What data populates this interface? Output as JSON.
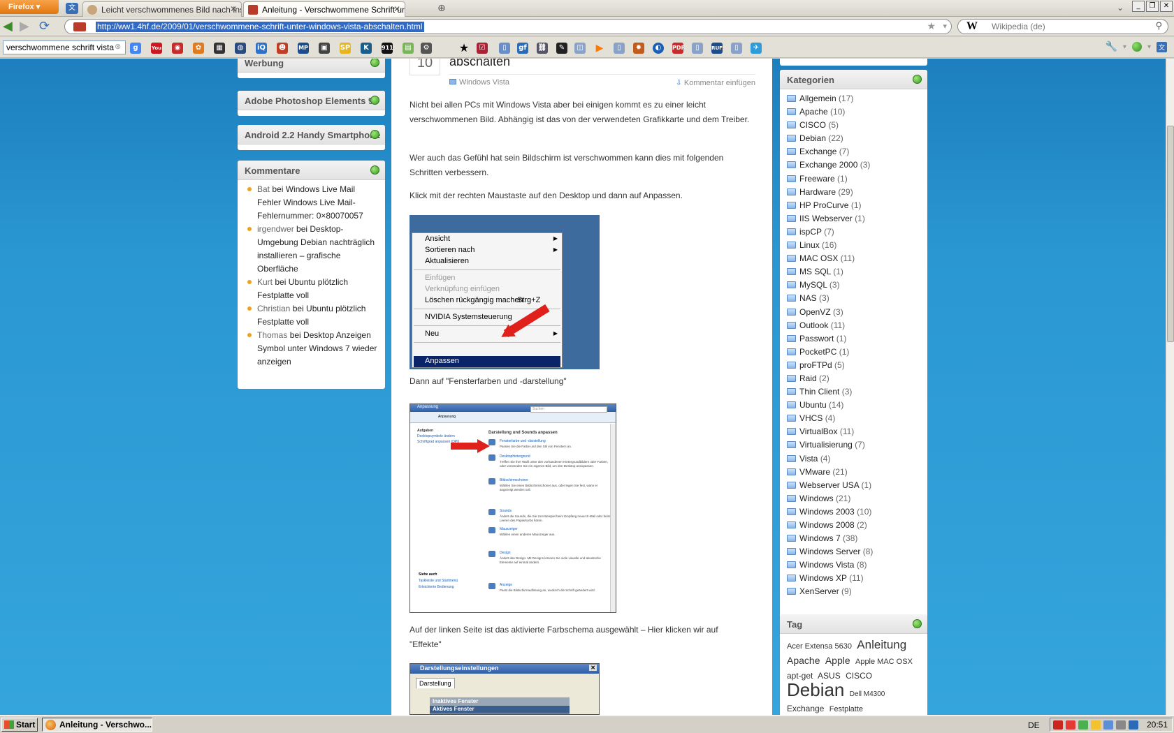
{
  "browser": {
    "app_button": "Firefox",
    "tabs": [
      {
        "title": "Leicht verschwommenes Bild nach Inst..."
      },
      {
        "title": "Anleitung - Verschwommene Schrift un..."
      }
    ],
    "url": "http://ww1.4hf.de/2009/01/verschwommene-schrift-unter-windows-vista-abschalten.html",
    "search_placeholder": "Wikipedia (de)",
    "search_engine_label": "W",
    "toolbar_search_value": "verschwommene schrift vista"
  },
  "left_sidebar": {
    "widgets": [
      {
        "title": "Werbung"
      },
      {
        "title": "Adobe Photoshop Elements 9"
      },
      {
        "title": "Android 2.2 Handy Smartphone"
      },
      {
        "title": "Kommentare"
      }
    ],
    "comments": [
      {
        "author": "Bat",
        "sep": " bei ",
        "post": "Windows Live Mail Fehler Windows Live Mail-Fehlernummer: 0×80070057"
      },
      {
        "author": "irgendwer",
        "sep": " bei ",
        "post": "Desktop-Umgebung Debian nachträglich installieren – grafische Oberfläche"
      },
      {
        "author": "Kurt",
        "sep": " bei ",
        "post": "Ubuntu plötzlich Festplatte voll"
      },
      {
        "author": "Christian",
        "sep": " bei ",
        "post": "Ubuntu plötzlich Festplatte voll"
      },
      {
        "author": "Thomas",
        "sep": " bei ",
        "post": "Desktop Anzeigen Symbol unter Windows 7 wieder anzeigen"
      }
    ]
  },
  "post": {
    "day": "10",
    "title": "abschalten",
    "category": "Windows Vista",
    "comment_link": "Kommentar einfügen",
    "paragraphs": [
      "Nicht bei allen PCs mit Windows Vista aber bei einigen kommt es zu einer leicht verschwommenen Bild. Abhängig ist das von der verwendeten Grafikkarte und dem Treiber.",
      "Wer auch das Gefühl hat sein Bildschirm ist verschwommen kann dies mit folgenden Schritten verbessern.",
      "Klick mit der rechten Maustaste auf den Desktop und dann auf Anpassen.",
      "Dann auf \"Fensterfarben und -darstellung\"",
      "Auf der linken Seite ist das aktivierte Farbschema ausgewählt – Hier klicken wir auf \"Effekte\""
    ],
    "context_menu": {
      "items": [
        "Ansicht",
        "Sortieren nach",
        "Aktualisieren",
        "Einfügen",
        "Verknüpfung einfügen",
        "Löschen rückgängig machen",
        "Strg+Z",
        "NVIDIA Systemsteuerung",
        "Neu",
        "Anpassen"
      ]
    },
    "shot2": {
      "title": "Anpassung",
      "address": "Anpassung",
      "search": "Suchen",
      "tasks_header": "Aufgaben",
      "tasks": [
        "Desktopsymbole ändern",
        "Schriftgrad anpassen (DPI)"
      ],
      "heading": "Darstellung und Sounds anpassen",
      "entries": [
        {
          "link": "Fensterfarbe und -darstellung",
          "text": "Passen Sie die Farbe und den Stil von Fenstern an."
        },
        {
          "link": "Desktophintergrund",
          "text": "Treffen Sie Ihre Wahl unter den vorhandenen Hintergrundbildern oder Farben, oder verwenden Sie ein eigenes Bild, um den Desktop anzupassen."
        },
        {
          "link": "Bildschirmschoner",
          "text": "Wählen Sie einen Bildschirmschoner aus, oder legen Sie fest, wann er angezeigt werden soll."
        },
        {
          "link": "Sounds",
          "text": "Ändert die Sounds, die Sie zum Beispiel beim Empfang neuer E-Mail oder beim Leeren des Papierkorbs hören."
        },
        {
          "link": "Mauszeiger",
          "text": "Wählen einen anderen Mauszeiger aus."
        },
        {
          "link": "Design",
          "text": "Ändert das Design. Mit Designs können Sie viele visuelle und akustische Elemente auf einmal ändern."
        },
        {
          "link": "Anzeige",
          "text": "Passt die Bildschirmauflösung an, wodurch die Schrift geändert wird."
        }
      ],
      "see_also": "Siehe auch",
      "see_links": [
        "Taskleiste und Startmenü",
        "Erleichterte Bedienung"
      ]
    },
    "shot3": {
      "title": "Darstellungseinstellungen",
      "tab": "Darstellung",
      "inner_title": "Inaktives Fenster",
      "inner_title2": "Aktives Fenster"
    }
  },
  "right_sidebar": {
    "categories_title": "Kategorien",
    "categories": [
      {
        "name": "Allgemein",
        "count": "(17)"
      },
      {
        "name": "Apache",
        "count": "(10)"
      },
      {
        "name": "CISCO",
        "count": "(5)"
      },
      {
        "name": "Debian",
        "count": "(22)"
      },
      {
        "name": "Exchange",
        "count": "(7)"
      },
      {
        "name": "Exchange 2000",
        "count": "(3)"
      },
      {
        "name": "Freeware",
        "count": "(1)"
      },
      {
        "name": "Hardware",
        "count": "(29)"
      },
      {
        "name": "HP ProCurve",
        "count": "(1)"
      },
      {
        "name": "IIS Webserver",
        "count": "(1)"
      },
      {
        "name": "ispCP",
        "count": "(7)"
      },
      {
        "name": "Linux",
        "count": "(16)"
      },
      {
        "name": "MAC OSX",
        "count": "(11)"
      },
      {
        "name": "MS SQL",
        "count": "(1)"
      },
      {
        "name": "MySQL",
        "count": "(3)"
      },
      {
        "name": "NAS",
        "count": "(3)"
      },
      {
        "name": "OpenVZ",
        "count": "(3)"
      },
      {
        "name": "Outlook",
        "count": "(11)"
      },
      {
        "name": "Passwort",
        "count": "(1)"
      },
      {
        "name": "PocketPC",
        "count": "(1)"
      },
      {
        "name": "proFTPd",
        "count": "(5)"
      },
      {
        "name": "Raid",
        "count": "(2)"
      },
      {
        "name": "Thin Client",
        "count": "(3)"
      },
      {
        "name": "Ubuntu",
        "count": "(14)"
      },
      {
        "name": "VHCS",
        "count": "(4)"
      },
      {
        "name": "VirtualBox",
        "count": "(11)"
      },
      {
        "name": "Virtualisierung",
        "count": "(7)"
      },
      {
        "name": "Vista",
        "count": "(4)"
      },
      {
        "name": "VMware",
        "count": "(21)"
      },
      {
        "name": "Webserver USA",
        "count": "(1)"
      },
      {
        "name": "Windows",
        "count": "(21)"
      },
      {
        "name": "Windows 2003",
        "count": "(10)"
      },
      {
        "name": "Windows 2008",
        "count": "(2)"
      },
      {
        "name": "Windows 7",
        "count": "(38)"
      },
      {
        "name": "Windows Server",
        "count": "(8)"
      },
      {
        "name": "Windows Vista",
        "count": "(8)"
      },
      {
        "name": "Windows XP",
        "count": "(11)"
      },
      {
        "name": "XenServer",
        "count": "(9)"
      }
    ],
    "tag_title": "Tag",
    "tags": [
      {
        "text": "Acer Extensa 5630",
        "size": 11
      },
      {
        "text": "Anleitung",
        "size": 17
      },
      {
        "text": "Apache",
        "size": 14
      },
      {
        "text": "Apple",
        "size": 14
      },
      {
        "text": "Apple MAC OSX",
        "size": 11
      },
      {
        "text": "apt-get",
        "size": 12
      },
      {
        "text": "ASUS",
        "size": 12
      },
      {
        "text": "CISCO",
        "size": 12
      },
      {
        "text": "Debian",
        "size": 26
      },
      {
        "text": "Dell M4300",
        "size": 10
      },
      {
        "text": "Exchange",
        "size": 12
      },
      {
        "text": "Festplatte",
        "size": 11
      }
    ]
  },
  "taskbar": {
    "start": "Start",
    "task": "Anleitung - Verschwo...",
    "lang": "DE",
    "time": "20:51"
  }
}
